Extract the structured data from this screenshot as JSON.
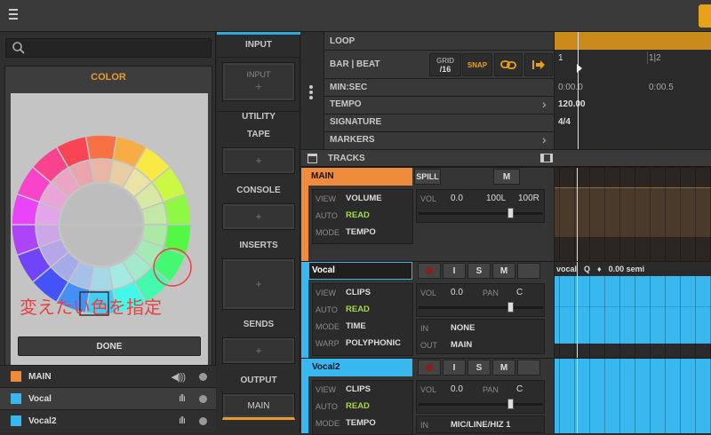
{
  "colors": {
    "accent": "#e89a30",
    "main": "#ef8c3c",
    "vocal": "#38b8ef",
    "orange_lane": "#cb8a1c"
  },
  "topbar": {
    "menu_icon": "hamburger-icon",
    "right_icon": "panel-menu-icon"
  },
  "color_panel": {
    "search_placeholder": "",
    "title": "COLOR",
    "annotation": "変えたい色を指定",
    "done_label": "DONE",
    "tracks": [
      {
        "name": "MAIN",
        "color": "#ef8c3c",
        "icon": "speaker-icon"
      },
      {
        "name": "Vocal",
        "color": "#38b8ef",
        "icon": "waveform-icon"
      },
      {
        "name": "Vocal2",
        "color": "#38b8ef",
        "icon": "waveform-icon"
      }
    ]
  },
  "io_panel": {
    "input_header": "INPUT",
    "input_slot": "INPUT",
    "utility": "UTILITY",
    "tape": "TAPE",
    "console": "CONSOLE",
    "inserts": "INSERTS",
    "sends": "SENDS",
    "output": "OUTPUT",
    "output_slot": "MAIN",
    "plus": "+"
  },
  "ruler": {
    "loop": "LOOP",
    "bar_beat": "BAR | BEAT",
    "grid_label": "GRID",
    "grid_value": "/16",
    "snap": "SNAP",
    "min_sec": "MIN:SEC",
    "tempo": "TEMPO",
    "signature": "SIGNATURE",
    "markers": "MARKERS",
    "tracks": "TRACKS",
    "bar1": "1",
    "bar2": "1|2",
    "time1": "0:00.0",
    "time2": "0:00.5",
    "tempo_value": "120.00",
    "signature_value": "4/4",
    "chevron": "›"
  },
  "tracks": [
    {
      "name": "MAIN",
      "spill": "SPILL",
      "m": "M",
      "view_k": "VIEW",
      "view_v": "VOLUME",
      "auto_k": "AUTO",
      "auto_v": "READ",
      "mode_k": "MODE",
      "mode_v": "TEMPO",
      "vol": "VOL",
      "vol_v": "0.0",
      "l": "100L",
      "r": "100R"
    },
    {
      "name": "Vocal",
      "i": "I",
      "s": "S",
      "m": "M",
      "view_k": "VIEW",
      "view_v": "CLIPS",
      "auto_k": "AUTO",
      "auto_v": "READ",
      "mode_k": "MODE",
      "mode_v": "TIME",
      "warp_k": "WARP",
      "warp_v": "POLYPHONIC",
      "vol": "VOL",
      "vol_v": "0.0",
      "pan": "PAN",
      "pan_v": "C",
      "in": "IN",
      "in_v": "NONE",
      "out": "OUT",
      "out_v": "MAIN",
      "clip": "vocal",
      "q": "Q",
      "semi": "0.00 semi"
    },
    {
      "name": "Vocal2",
      "i": "I",
      "s": "S",
      "m": "M",
      "view_k": "VIEW",
      "view_v": "CLIPS",
      "auto_k": "AUTO",
      "auto_v": "READ",
      "mode_k": "MODE",
      "mode_v": "TEMPO",
      "vol": "VOL",
      "vol_v": "0.0",
      "pan": "PAN",
      "pan_v": "C",
      "in": "IN",
      "in_v": "MIC/LINE/HIZ 1"
    }
  ]
}
